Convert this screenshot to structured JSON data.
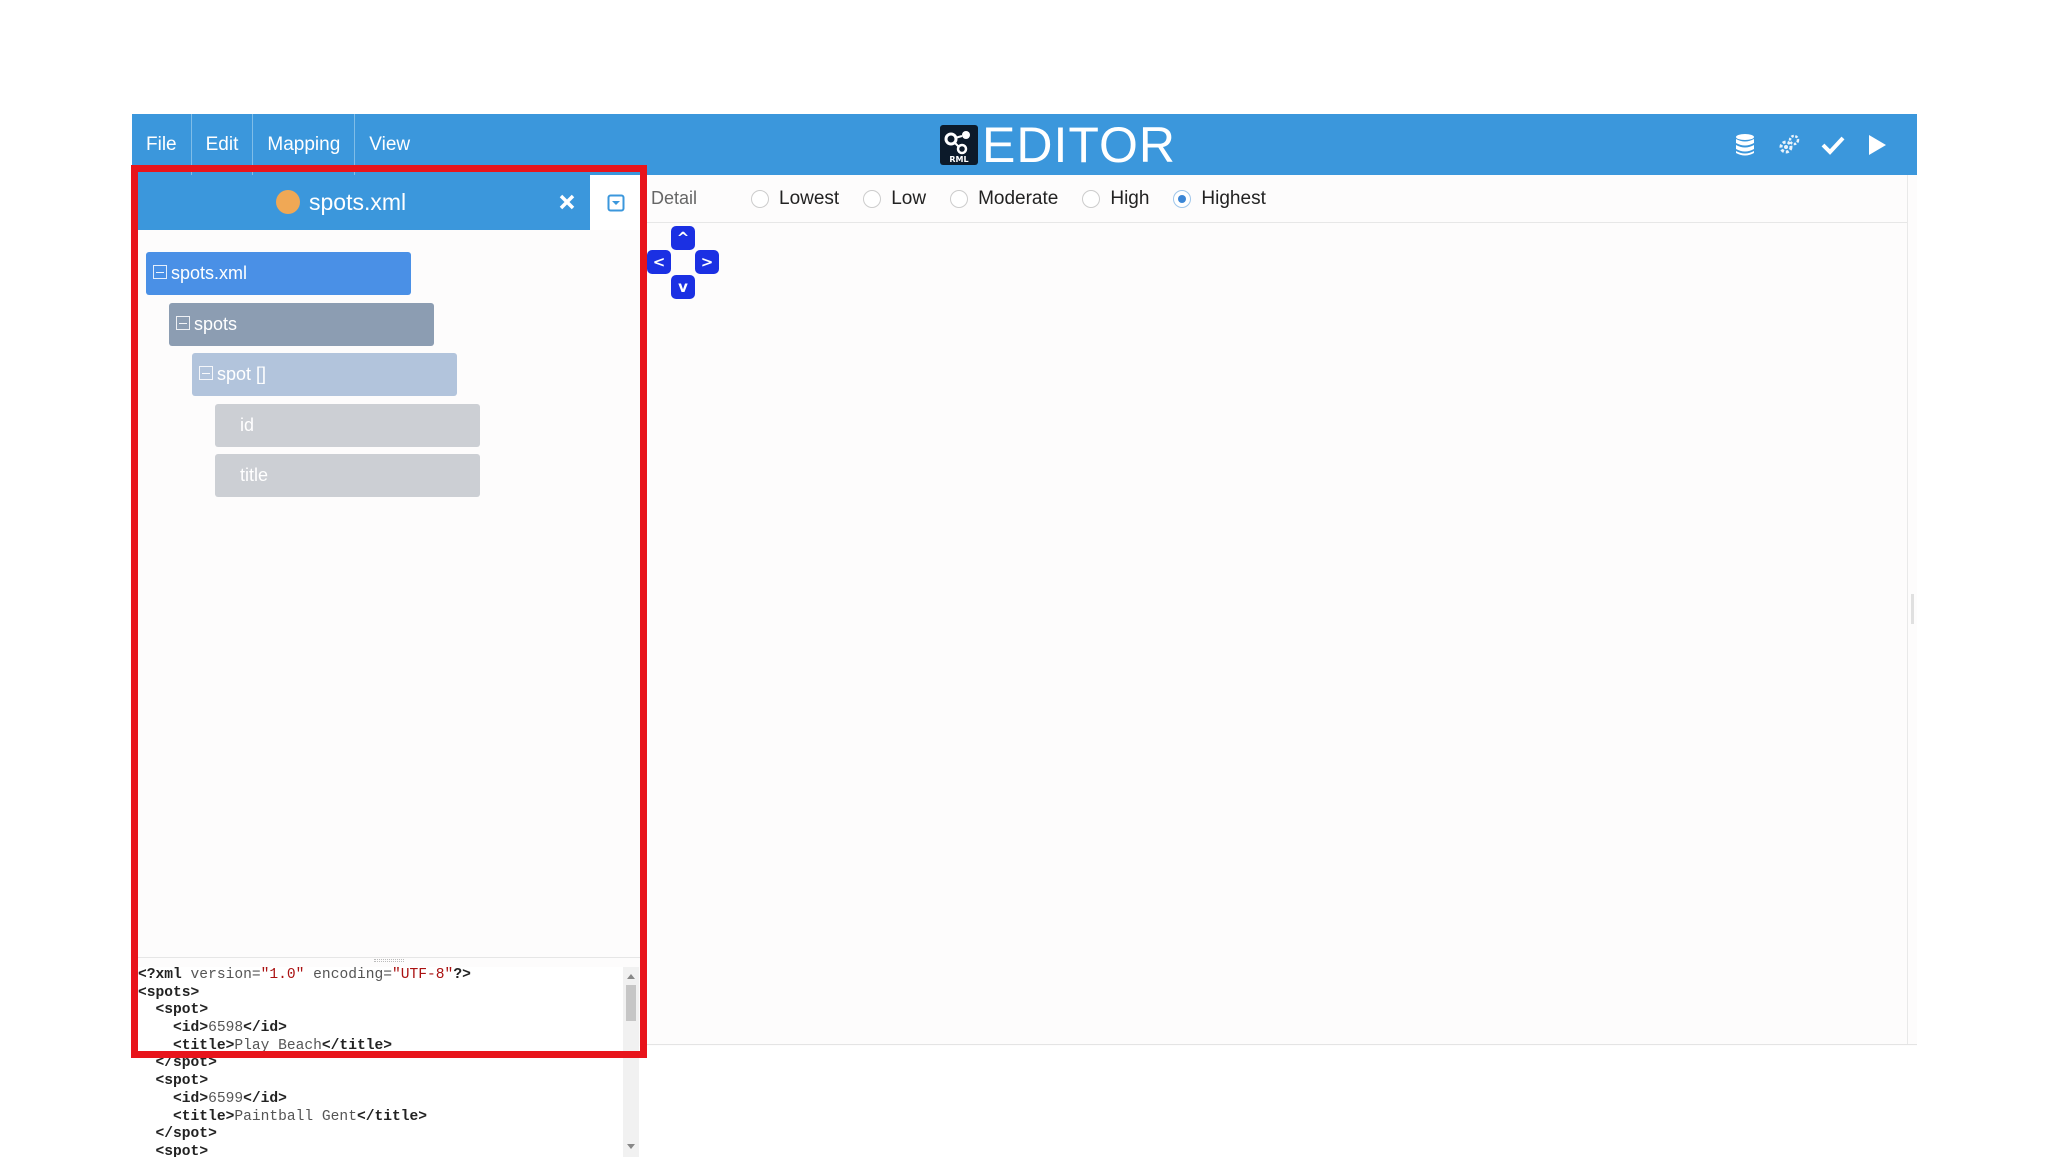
{
  "menu": [
    "File",
    "Edit",
    "Mapping",
    "View"
  ],
  "brand": {
    "title": "EDITOR",
    "logo_text": "RML"
  },
  "toolbar_icons": [
    "database-icon",
    "cogs-icon",
    "checkmark-icon",
    "play-icon"
  ],
  "colors": {
    "accent": "#3b97dc",
    "highlight": "#e8141b",
    "nav_buttons": "#1b30e3",
    "file_dot": "#f0a855"
  },
  "file_tab": {
    "name": "spots.xml"
  },
  "tree": [
    {
      "label": "spots.xml",
      "level": 0,
      "collapsible": true
    },
    {
      "label": "spots",
      "level": 1,
      "collapsible": true
    },
    {
      "label": "spot []",
      "level": 2,
      "collapsible": true
    },
    {
      "label": "id",
      "level": 3,
      "collapsible": false
    },
    {
      "label": "title",
      "level": 3,
      "collapsible": false
    }
  ],
  "source_code": [
    "<?xml version=\"1.0\" encoding=\"UTF-8\"?>",
    "<spots>",
    "  <spot>",
    "    <id>6598</id>",
    "    <title>Play Beach</title>",
    "  </spot>",
    "  <spot>",
    "    <id>6599</id>",
    "    <title>Paintball Gent</title>",
    "  </spot>",
    "  <spot>"
  ],
  "detail": {
    "label": "Detail",
    "options": [
      "Lowest",
      "Low",
      "Moderate",
      "High",
      "Highest"
    ],
    "selected": "Highest"
  },
  "nav": {
    "up": "^",
    "left": "<",
    "right": ">",
    "down": "v"
  }
}
